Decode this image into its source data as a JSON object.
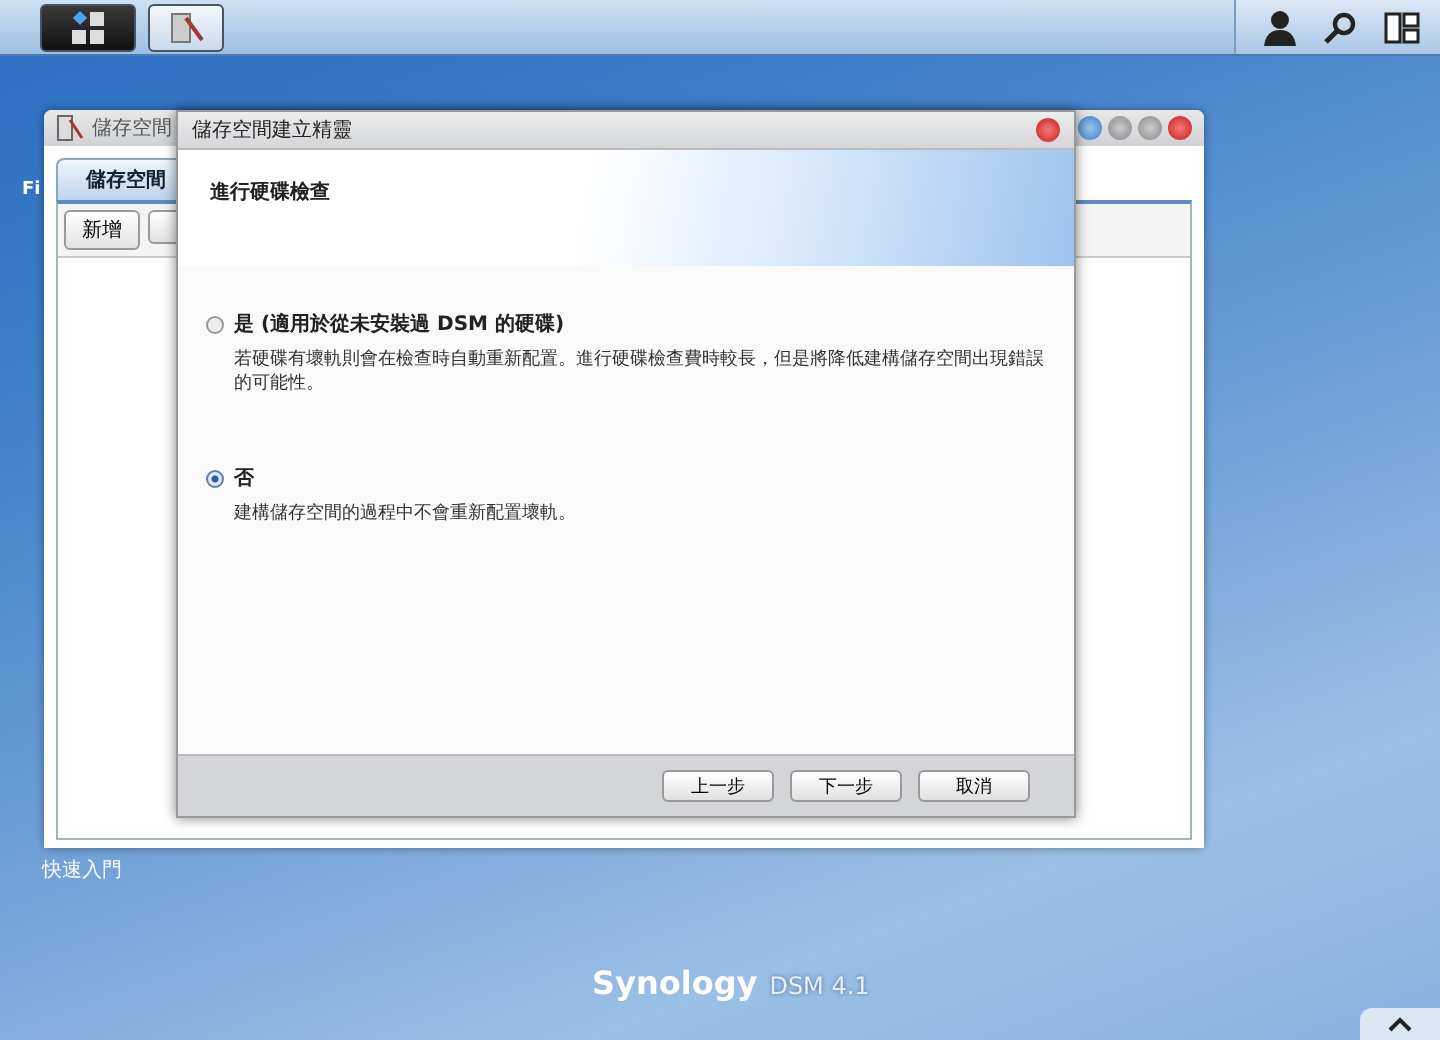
{
  "desktop": {
    "icons": [
      {
        "label": "Fi"
      },
      {
        "label": "快速入門"
      }
    ]
  },
  "background_window": {
    "title": "儲存空間",
    "tabs": [
      {
        "label": "儲存空間",
        "selected": true
      }
    ],
    "buttons": [
      "新增"
    ]
  },
  "wizard": {
    "title": "儲存空間建立精靈",
    "step_title": "進行硬碟檢查",
    "options": [
      {
        "label": "是 (適用於從未安裝過 DSM 的硬碟)",
        "description": "若硬碟有壞軌則會在檢查時自動重新配置。進行硬碟檢查費時較長，但是將降低建構儲存空間出現錯誤的可能性。",
        "selected": false
      },
      {
        "label": "否",
        "description": "建構儲存空間的過程中不會重新配置壞軌。",
        "selected": true
      }
    ],
    "buttons": [
      "上一步",
      "下一步",
      "取消"
    ]
  },
  "branding": {
    "brand": "Synology",
    "product": "DSM 4.1"
  }
}
